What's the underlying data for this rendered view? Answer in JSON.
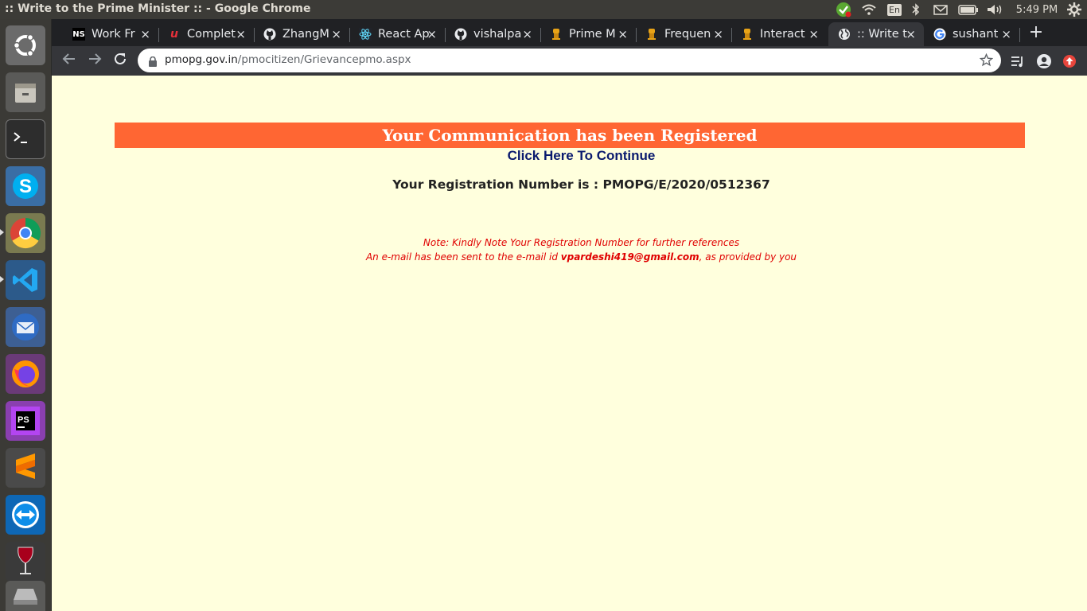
{
  "os": {
    "window_title": ":: Write to the Prime Minister :: - Google Chrome",
    "keyboard_layout": "En",
    "clock": "5:49 PM",
    "launcher": [
      {
        "name": "ubuntu-dash-icon"
      },
      {
        "name": "files-icon"
      },
      {
        "name": "terminal-icon"
      },
      {
        "name": "skype-icon"
      },
      {
        "name": "chrome-icon"
      },
      {
        "name": "vscode-icon"
      },
      {
        "name": "thunderbird-icon"
      },
      {
        "name": "firefox-icon"
      },
      {
        "name": "phpstorm-icon"
      },
      {
        "name": "sublime-icon"
      },
      {
        "name": "teamviewer-icon"
      },
      {
        "name": "wine-icon"
      },
      {
        "name": "drive-icon"
      }
    ]
  },
  "browser": {
    "tabs": [
      {
        "title": "Work Fr",
        "icon": "NS"
      },
      {
        "title": "Complet",
        "icon": "u"
      },
      {
        "title": "ZhangM",
        "icon": "github"
      },
      {
        "title": "React Ap",
        "icon": "react"
      },
      {
        "title": "vishalpa",
        "icon": "github"
      },
      {
        "title": "Prime M",
        "icon": "pmo"
      },
      {
        "title": "Frequen",
        "icon": "pmo"
      },
      {
        "title": "Interact",
        "icon": "pmo"
      },
      {
        "title": ":: Write t",
        "icon": "globe",
        "active": true
      },
      {
        "title": "sushant",
        "icon": "google"
      }
    ],
    "close_glyph": "×",
    "new_tab": "+",
    "url_host": "pmopg.gov.in",
    "url_path": "/pmocitizen/Grievancepmo.aspx"
  },
  "page": {
    "banner_title": "Your Communication has been Registered",
    "continue_link": "Click Here To Continue",
    "registration_label": "Your Registration Number is : ",
    "registration_number": "PMOPG/E/2020/0512367",
    "note": "Note: Kindly Note Your Registration Number for further references",
    "email_prefix": "An e-mail has been sent to the e-mail id ",
    "email_address": "vpardeshi419@gmail.com",
    "email_suffix": ", as provided by you"
  },
  "colors": {
    "banner": "#ff6633",
    "page_background": "#ffffdd",
    "link": "#0a1a6e",
    "note": "#e00000"
  }
}
